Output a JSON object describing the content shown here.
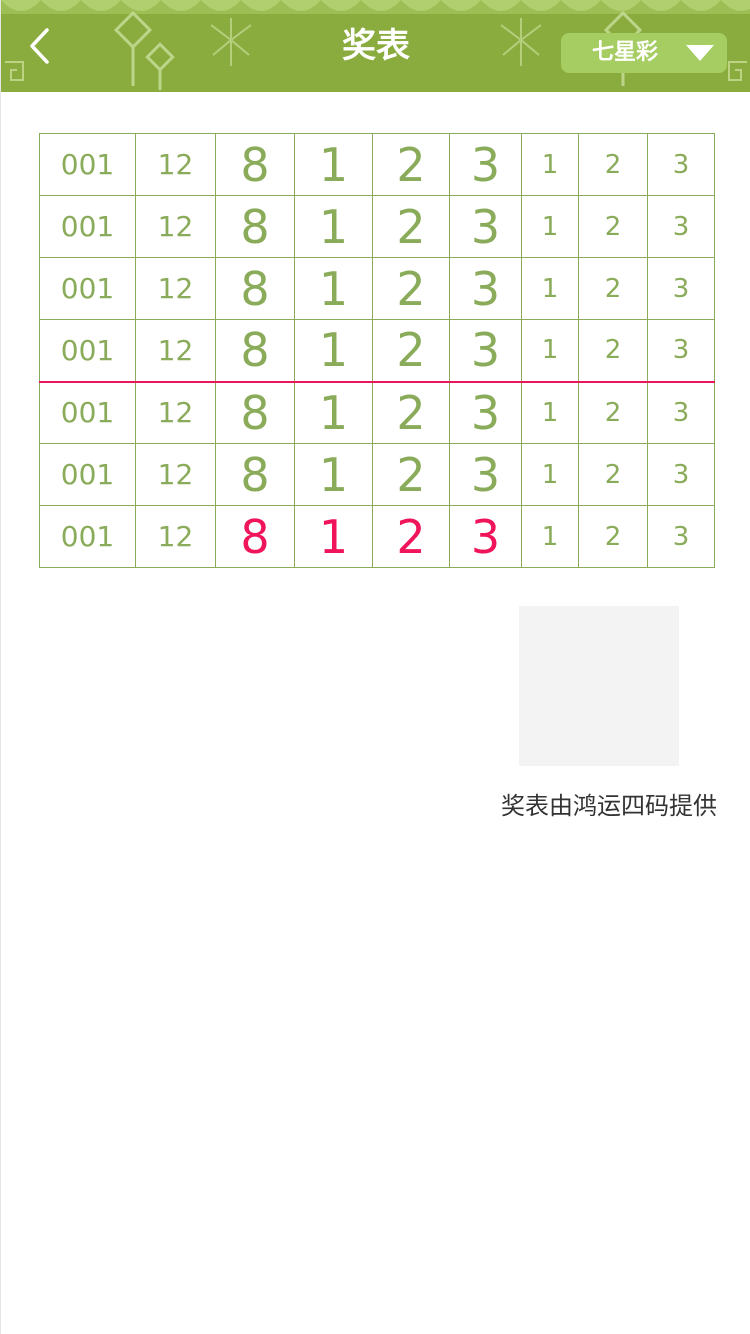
{
  "header": {
    "title": "奖表",
    "lottery_selector": "七星彩",
    "colors": {
      "bar": "#8aac3f",
      "selector": "#a6cd62"
    },
    "icons": {
      "back": "chevron-left-icon",
      "dropdown": "triangle-down-icon"
    }
  },
  "table": {
    "highlight_color": "#f0145a",
    "rows": [
      {
        "issue": "001",
        "sum": "12",
        "main": [
          "8",
          "1",
          "2",
          "3"
        ],
        "extra": [
          "1",
          "2",
          "3"
        ]
      },
      {
        "issue": "001",
        "sum": "12",
        "main": [
          "8",
          "1",
          "2",
          "3"
        ],
        "extra": [
          "1",
          "2",
          "3"
        ]
      },
      {
        "issue": "001",
        "sum": "12",
        "main": [
          "8",
          "1",
          "2",
          "3"
        ],
        "extra": [
          "1",
          "2",
          "3"
        ]
      },
      {
        "issue": "001",
        "sum": "12",
        "main": [
          "8",
          "1",
          "2",
          "3"
        ],
        "extra": [
          "1",
          "2",
          "3"
        ]
      },
      {
        "issue": "001",
        "sum": "12",
        "main": [
          "8",
          "1",
          "2",
          "3"
        ],
        "extra": [
          "1",
          "2",
          "3"
        ]
      },
      {
        "issue": "001",
        "sum": "12",
        "main": [
          "8",
          "1",
          "2",
          "3"
        ],
        "extra": [
          "1",
          "2",
          "3"
        ]
      },
      {
        "issue": "001",
        "sum": "12",
        "main": [
          "8",
          "1",
          "2",
          "3"
        ],
        "extra": [
          "1",
          "2",
          "3"
        ]
      }
    ]
  },
  "footer": {
    "credit": "奖表由鸿运四码提供"
  }
}
